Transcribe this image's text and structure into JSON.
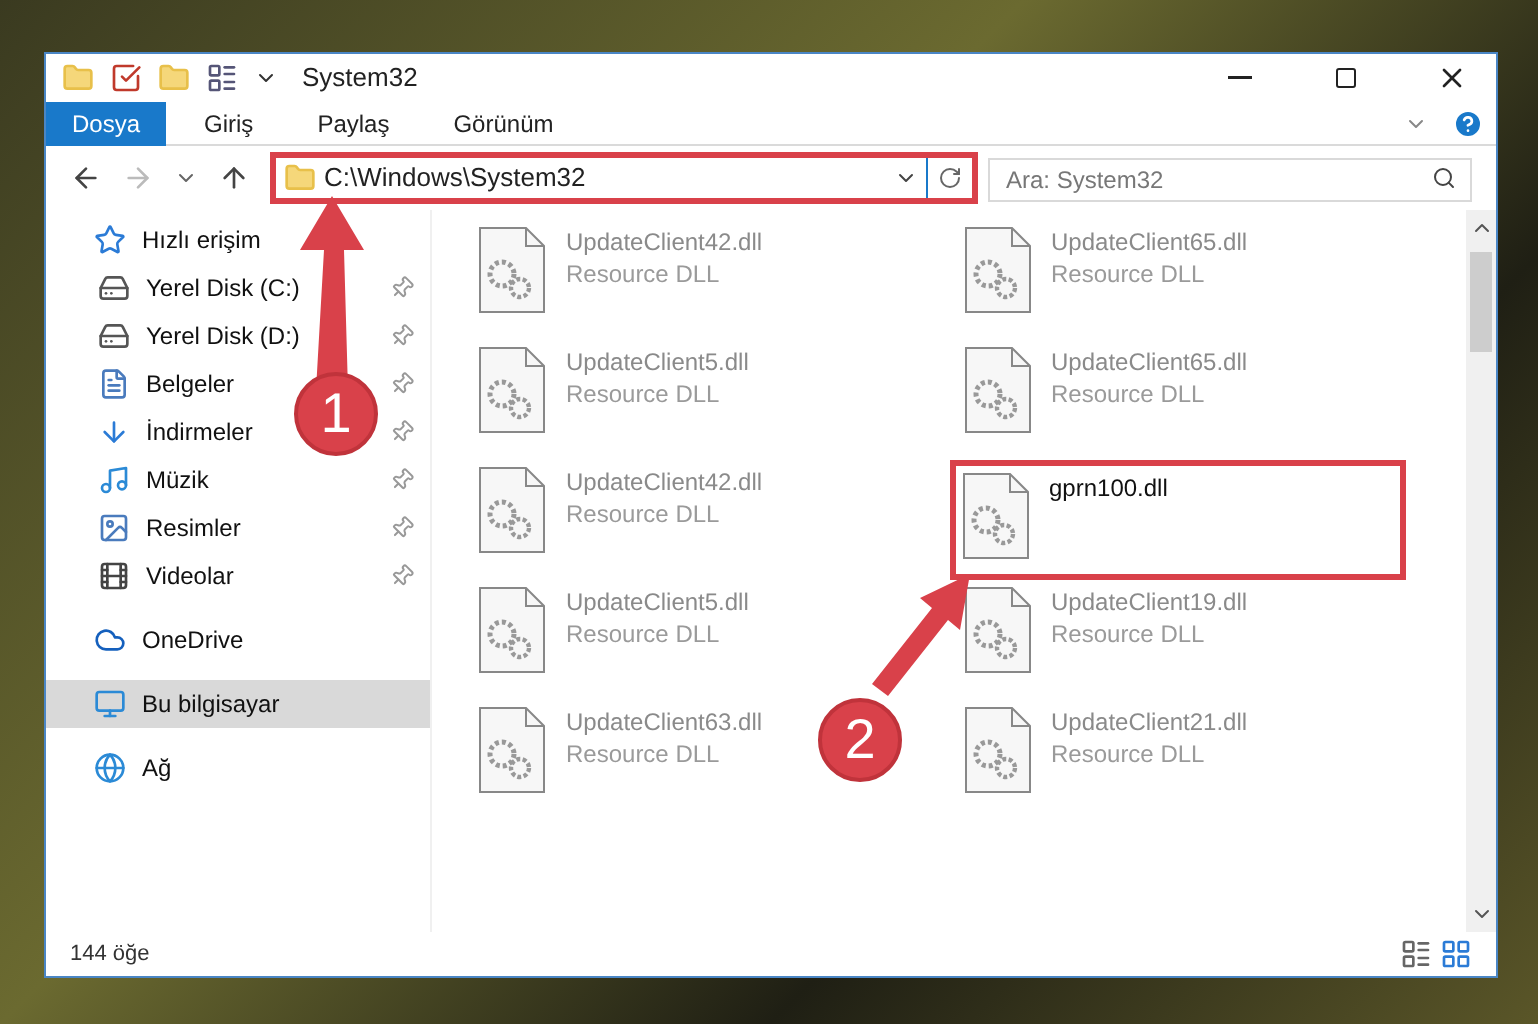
{
  "window": {
    "title": "System32"
  },
  "ribbon_tabs": [
    {
      "label": "Dosya",
      "selected": true
    },
    {
      "label": "Giriş",
      "selected": false
    },
    {
      "label": "Paylaş",
      "selected": false
    },
    {
      "label": "Görünüm",
      "selected": false
    }
  ],
  "address_bar": {
    "path": "C:\\Windows\\System32",
    "highlighted": true
  },
  "search": {
    "placeholder": "Ara: System32"
  },
  "sidebar": {
    "items": [
      {
        "label": "Hızlı erişim",
        "selected": false,
        "children": [
          {
            "label": "Yerel Disk (C:)",
            "pinned": true,
            "selected": false
          },
          {
            "label": "Yerel Disk (D:)",
            "pinned": true,
            "selected": false
          },
          {
            "label": "Belgeler",
            "pinned": true,
            "selected": false
          },
          {
            "label": "İndirmeler",
            "pinned": true,
            "selected": false
          },
          {
            "label": "Müzik",
            "pinned": true,
            "selected": false
          },
          {
            "label": "Resimler",
            "pinned": true,
            "selected": false
          },
          {
            "label": "Videolar",
            "pinned": true,
            "selected": false
          }
        ]
      },
      {
        "label": "OneDrive",
        "selected": false
      },
      {
        "label": "Bu bilgisayar",
        "selected": true
      },
      {
        "label": "Ağ",
        "selected": false
      }
    ]
  },
  "files": [
    {
      "name": "UpdateClient42.dll",
      "type": "Resource DLL",
      "dimmed": true,
      "highlighted": false
    },
    {
      "name": "UpdateClient65.dll",
      "type": "Resource DLL",
      "dimmed": true,
      "highlighted": false
    },
    {
      "name": "UpdateClient5.dll",
      "type": "Resource DLL",
      "dimmed": true,
      "highlighted": false
    },
    {
      "name": "UpdateClient65.dll",
      "type": "Resource DLL",
      "dimmed": true,
      "highlighted": false
    },
    {
      "name": "UpdateClient42.dll",
      "type": "Resource DLL",
      "dimmed": true,
      "highlighted": false
    },
    {
      "name": "gprn100.dll",
      "dimmed": false,
      "highlighted": true
    },
    {
      "name": "UpdateClient5.dll",
      "type": "Resource DLL",
      "dimmed": true,
      "highlighted": false
    },
    {
      "name": "UpdateClient19.dll",
      "type": "Resource DLL",
      "dimmed": true,
      "highlighted": false
    },
    {
      "name": "UpdateClient63.dll",
      "type": "Resource DLL",
      "dimmed": true,
      "highlighted": false
    },
    {
      "name": "UpdateClient21.dll",
      "type": "Resource DLL",
      "dimmed": true,
      "highlighted": false
    }
  ],
  "status_bar": {
    "item_count": "144 öğe"
  },
  "annotations": [
    {
      "label": "1"
    },
    {
      "label": "2"
    }
  ]
}
